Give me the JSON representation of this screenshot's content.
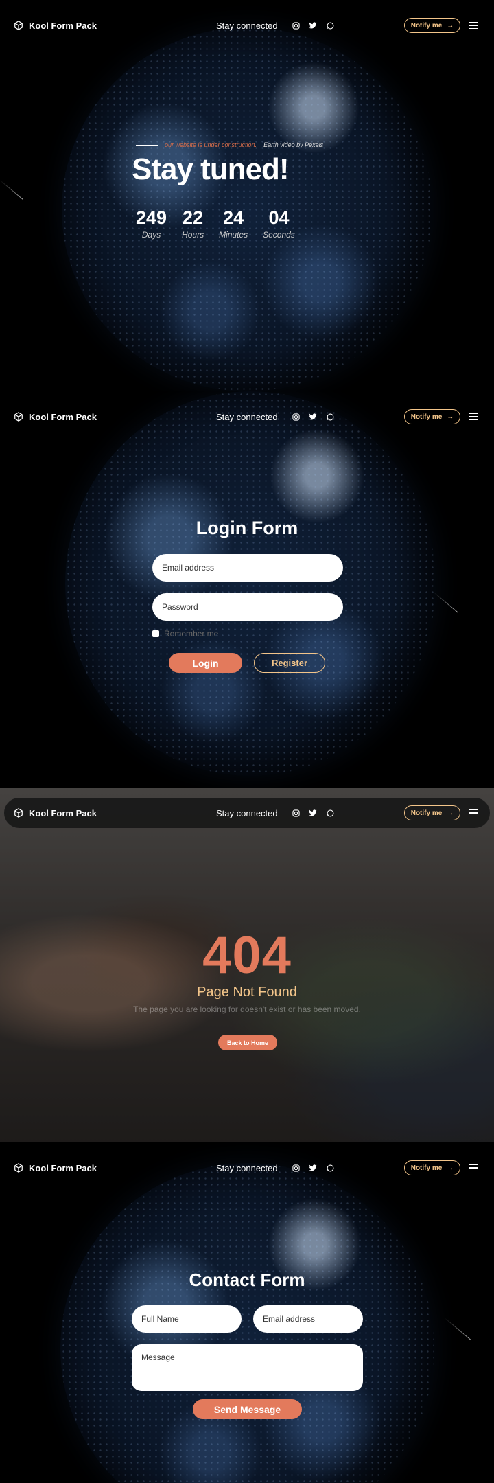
{
  "nav": {
    "brand": "Kool Form Pack",
    "stay": "Stay connected",
    "social": [
      "instagram-icon",
      "twitter-icon",
      "whatsapp-icon"
    ],
    "notify_label": "Notify me",
    "notify_arrow": "→"
  },
  "hero": {
    "tagline_orange": "our website is under construction.",
    "tagline_rest": "Earth video by Pexels",
    "title": "Stay tuned!",
    "countdown": [
      {
        "value": "249",
        "label": "Days"
      },
      {
        "value": "22",
        "label": "Hours"
      },
      {
        "value": "24",
        "label": "Minutes"
      },
      {
        "value": "04",
        "label": "Seconds"
      }
    ]
  },
  "login": {
    "title": "Login Form",
    "email_placeholder": "Email address",
    "password_placeholder": "Password",
    "remember_label": "Remember me",
    "login_label": "Login",
    "register_label": "Register"
  },
  "error": {
    "code": "404",
    "title": "Page Not Found",
    "description": "The page you are looking for doesn't exist or has been moved.",
    "button": "Back to Home"
  },
  "contact": {
    "title": "Contact Form",
    "name_placeholder": "Full Name",
    "email_placeholder": "Email address",
    "message_placeholder": "Message",
    "send_label": "Send Message"
  },
  "colors": {
    "accent": "#e37a5c",
    "gold": "#f3c58a"
  }
}
